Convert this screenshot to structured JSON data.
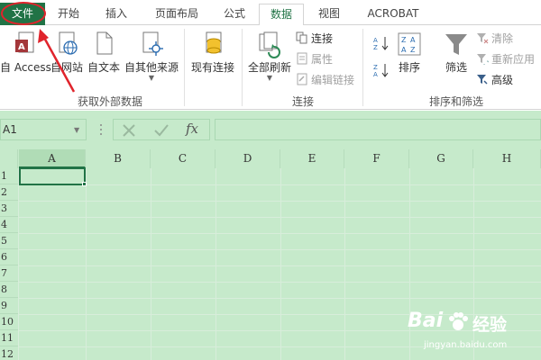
{
  "tabs": [
    {
      "label": "文件"
    },
    {
      "label": "开始"
    },
    {
      "label": "插入"
    },
    {
      "label": "页面布局"
    },
    {
      "label": "公式"
    },
    {
      "label": "数据"
    },
    {
      "label": "视图"
    },
    {
      "label": "ACROBAT"
    }
  ],
  "ribbon": {
    "get_external": {
      "access": "自 Access",
      "web": "自网站",
      "text": "自文本",
      "other": "自其他来源",
      "existing": "现有连接",
      "group_label": "获取外部数据"
    },
    "connections": {
      "refresh_all": "全部刷新",
      "connections": "连接",
      "properties": "属性",
      "edit_links": "编辑链接",
      "group_label": "连接"
    },
    "sort_filter": {
      "sort": "排序",
      "filter": "筛选",
      "clear": "清除",
      "reapply": "重新应用",
      "advanced": "高级",
      "group_label": "排序和筛选"
    }
  },
  "formula_bar": {
    "name_box": "A1",
    "fx": "fx",
    "value": ""
  },
  "grid": {
    "columns": [
      "A",
      "B",
      "C",
      "D",
      "E",
      "F",
      "G",
      "H"
    ],
    "rows": [
      "1",
      "2",
      "3",
      "4",
      "5",
      "6",
      "7",
      "8",
      "9",
      "10",
      "11",
      "12"
    ],
    "active_cell": "A1"
  },
  "watermark": {
    "brand_left": "Bai",
    "brand_right": "经验",
    "url": "jingyan.baidu.com"
  },
  "colors": {
    "excel_green": "#217346",
    "eye_protect_green": "#c6eacb",
    "annotation_red": "#e0242c"
  }
}
